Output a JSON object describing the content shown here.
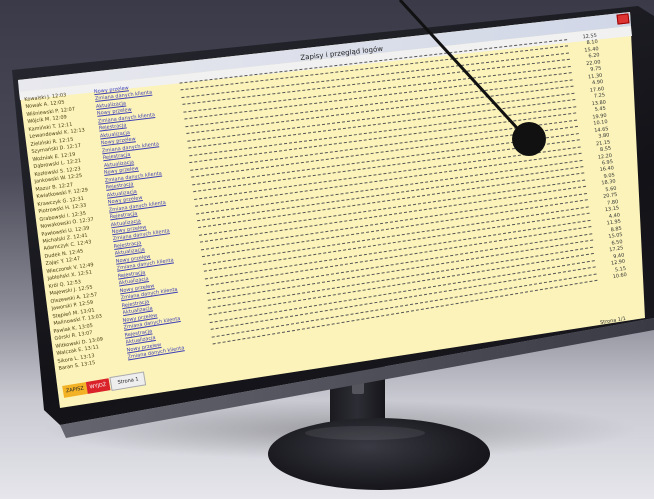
{
  "window": {
    "title": "Zapisy i przegląd logów",
    "status": {
      "badge1": "ZAPISZ",
      "badge2": "WYJDŹ",
      "badge3": "Strona 1"
    },
    "footer": "Strona 1/1"
  },
  "rows": [
    {
      "name": "Kowalski J.  12:03",
      "link": "Nowy przelew",
      "value": "12.55"
    },
    {
      "name": "Nowak A.  12:05",
      "link": "Zmiana danych klienta",
      "value": "8.10"
    },
    {
      "name": "Wiśniewski P.  12:07",
      "link": "Aktualizacja",
      "value": "15.40"
    },
    {
      "name": "Wójcik M.  12:09",
      "link": "Nowy przelew",
      "value": "6.20"
    },
    {
      "name": "Kamiński T.  12:11",
      "link": "Zmiana danych klienta",
      "value": "22.00"
    },
    {
      "name": "Lewandowski K.  12:13",
      "link": "Rejestracja",
      "value": "9.75"
    },
    {
      "name": "Zieliński R.  12:15",
      "link": "Aktualizacja",
      "value": "11.30"
    },
    {
      "name": "Szymański D.  12:17",
      "link": "Nowy przelew",
      "value": "4.90"
    },
    {
      "name": "Woźniak E.  12:19",
      "link": "Zmiana danych klienta",
      "value": "17.60"
    },
    {
      "name": "Dąbrowski L.  12:21",
      "link": "Rejestracja",
      "value": "7.25"
    },
    {
      "name": "Kozłowski S.  12:23",
      "link": "Aktualizacja",
      "value": "13.80"
    },
    {
      "name": "Jankowski W.  12:25",
      "link": "Nowy przelew",
      "value": "5.45"
    },
    {
      "name": "Mazur B.  12:27",
      "link": "Zmiana danych klienta",
      "value": "19.90"
    },
    {
      "name": "Kwiatkowski F.  12:29",
      "link": "Rejestracja",
      "value": "10.10"
    },
    {
      "name": "Krawczyk G.  12:31",
      "link": "Aktualizacja",
      "value": "14.65"
    },
    {
      "name": "Piotrowski H.  12:33",
      "link": "Nowy przelew",
      "value": "3.80"
    },
    {
      "name": "Grabowski I.  12:35",
      "link": "Zmiana danych klienta",
      "value": "21.15"
    },
    {
      "name": "Nowakowski O.  12:37",
      "link": "Rejestracja",
      "value": "8.55"
    },
    {
      "name": "Pawłowski U.  12:39",
      "link": "Aktualizacja",
      "value": "12.20"
    },
    {
      "name": "Michalski Z.  12:41",
      "link": "Nowy przelew",
      "value": "6.95"
    },
    {
      "name": "Adamczyk C.  12:43",
      "link": "Zmiana danych klienta",
      "value": "16.40"
    },
    {
      "name": "Dudek N.  12:45",
      "link": "Rejestracja",
      "value": "9.05"
    },
    {
      "name": "Zając Y.  12:47",
      "link": "Aktualizacja",
      "value": "18.30"
    },
    {
      "name": "Wieczorek V.  12:49",
      "link": "Nowy przelew",
      "value": "5.60"
    },
    {
      "name": "Jabłoński X.  12:51",
      "link": "Zmiana danych klienta",
      "value": "20.75"
    },
    {
      "name": "Król Q.  12:53",
      "link": "Rejestracja",
      "value": "7.80"
    },
    {
      "name": "Majewski J.  12:55",
      "link": "Aktualizacja",
      "value": "13.15"
    },
    {
      "name": "Olszewski A.  12:57",
      "link": "Nowy przelew",
      "value": "4.40"
    },
    {
      "name": "Jaworski P.  12:59",
      "link": "Zmiana danych klienta",
      "value": "11.95"
    },
    {
      "name": "Stępień M.  13:01",
      "link": "Rejestracja",
      "value": "8.85"
    },
    {
      "name": "Malinowski T.  13:03",
      "link": "Aktualizacja",
      "value": "15.05"
    },
    {
      "name": "Pawlak K.  13:05",
      "link": "Nowy przelew",
      "value": "6.50"
    },
    {
      "name": "Górski R.  13:07",
      "link": "Zmiana danych klienta",
      "value": "17.25"
    },
    {
      "name": "Witkowski D.  13:09",
      "link": "Rejestracja",
      "value": "9.40"
    },
    {
      "name": "Walczak E.  13:11",
      "link": "Aktualizacja",
      "value": "12.90"
    },
    {
      "name": "Sikora L.  13:13",
      "link": "Nowy przelew",
      "value": "5.15"
    },
    {
      "name": "Baran S.  13:15",
      "link": "Zmiana danych klienta",
      "value": "10.60"
    }
  ],
  "colors": {
    "screen_bg": "#fbf3b9",
    "link": "#3f3fb6",
    "callout": "#111111"
  }
}
